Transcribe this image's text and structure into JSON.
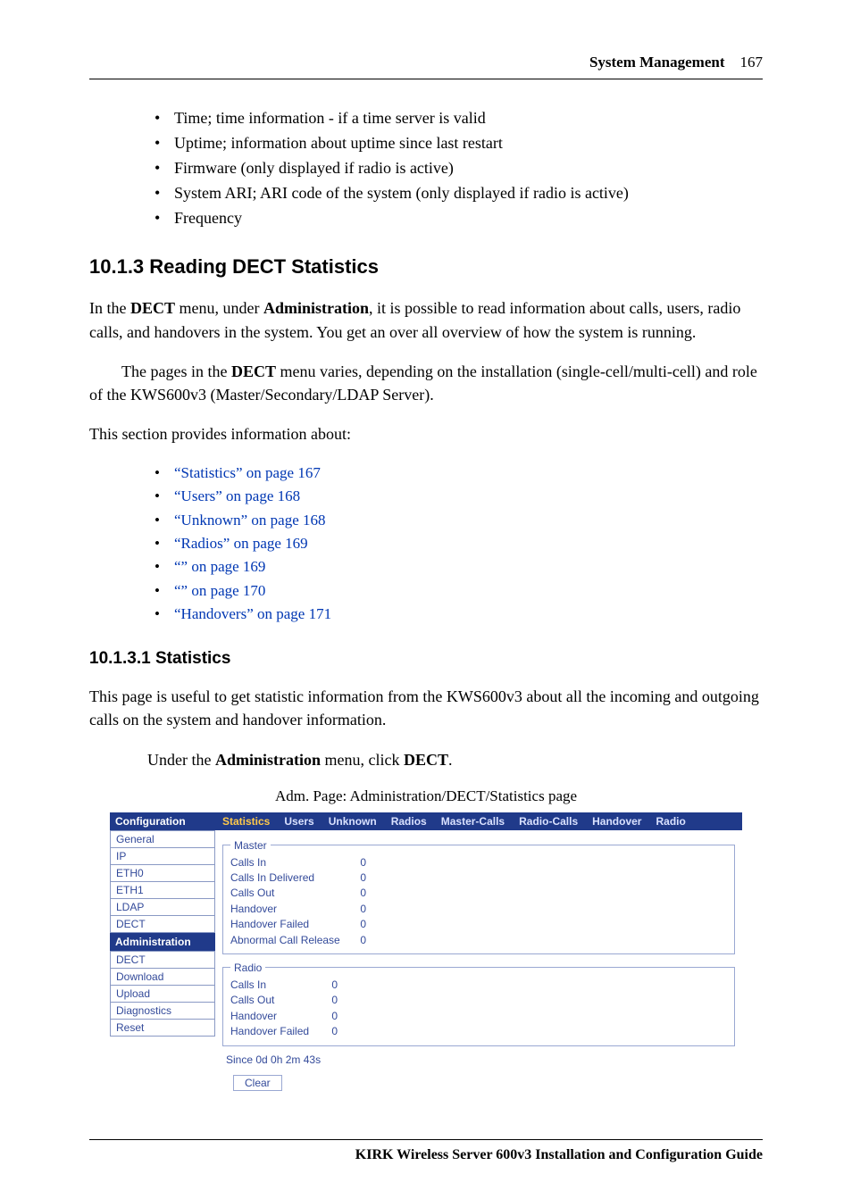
{
  "header": {
    "section": "System Management",
    "page": "167"
  },
  "intro_bullets": [
    "Time; time information - if a time server is valid",
    "Uptime; information about uptime since last restart",
    "Firmware (only displayed if radio is active)",
    "System ARI; ARI code of the system (only displayed if radio is active)",
    "Frequency"
  ],
  "h2": "10.1.3  Reading DECT Statistics",
  "p1a": "In the ",
  "p1b": "DECT",
  "p1c": " menu, under ",
  "p1d": "Administration",
  "p1e": ", it is possible to read information about calls, users, radio calls, and handovers in the system. You get an over all overview of how the system is running.",
  "p2a": "The pages in the ",
  "p2b": "DECT",
  "p2c": " menu varies, depending on the installation (single-cell/multi-cell) and role of the KWS600v3 (Master/Secondary/LDAP Server).",
  "p3": "This section provides information about:",
  "links": [
    "“Statistics” on page 167",
    "“Users” on page 168",
    "“Unknown” on page 168",
    "“Radios” on page 169",
    "“” on page 169",
    "“” on page 170",
    "“Handovers” on page 171"
  ],
  "h3": "10.1.3.1  Statistics",
  "p4": "This page is useful to get statistic information from the KWS600v3 about all the incoming and outgoing calls on the system and handover information.",
  "p5a": "Under the ",
  "p5b": "Administration",
  "p5c": " menu, click ",
  "p5d": "DECT",
  "p5e": ".",
  "caption": "Adm. Page: Administration/DECT/Statistics page",
  "shot": {
    "sidebar": {
      "group1": {
        "head": "Configuration",
        "items": [
          "General",
          "IP",
          "ETH0",
          "ETH1",
          "LDAP",
          "DECT"
        ]
      },
      "group2": {
        "head": "Administration",
        "items": [
          "DECT",
          "Download",
          "Upload",
          "Diagnostics",
          "Reset"
        ]
      }
    },
    "tabs": [
      "Statistics",
      "Users",
      "Unknown",
      "Radios",
      "Master-Calls",
      "Radio-Calls",
      "Handover",
      "Radio"
    ],
    "master": {
      "legend": "Master",
      "rows": [
        {
          "k": "Calls In",
          "v": "0"
        },
        {
          "k": "Calls In Delivered",
          "v": "0"
        },
        {
          "k": "Calls Out",
          "v": "0"
        },
        {
          "k": "Handover",
          "v": "0"
        },
        {
          "k": "Handover Failed",
          "v": "0"
        },
        {
          "k": "Abnormal Call Release",
          "v": "0"
        }
      ]
    },
    "radio": {
      "legend": "Radio",
      "rows": [
        {
          "k": "Calls In",
          "v": "0"
        },
        {
          "k": "Calls Out",
          "v": "0"
        },
        {
          "k": "Handover",
          "v": "0"
        },
        {
          "k": "Handover Failed",
          "v": "0"
        }
      ]
    },
    "since": "Since 0d  0h  2m  43s",
    "clear": "Clear"
  },
  "footer": "KIRK Wireless Server 600v3 Installation and Configuration Guide"
}
